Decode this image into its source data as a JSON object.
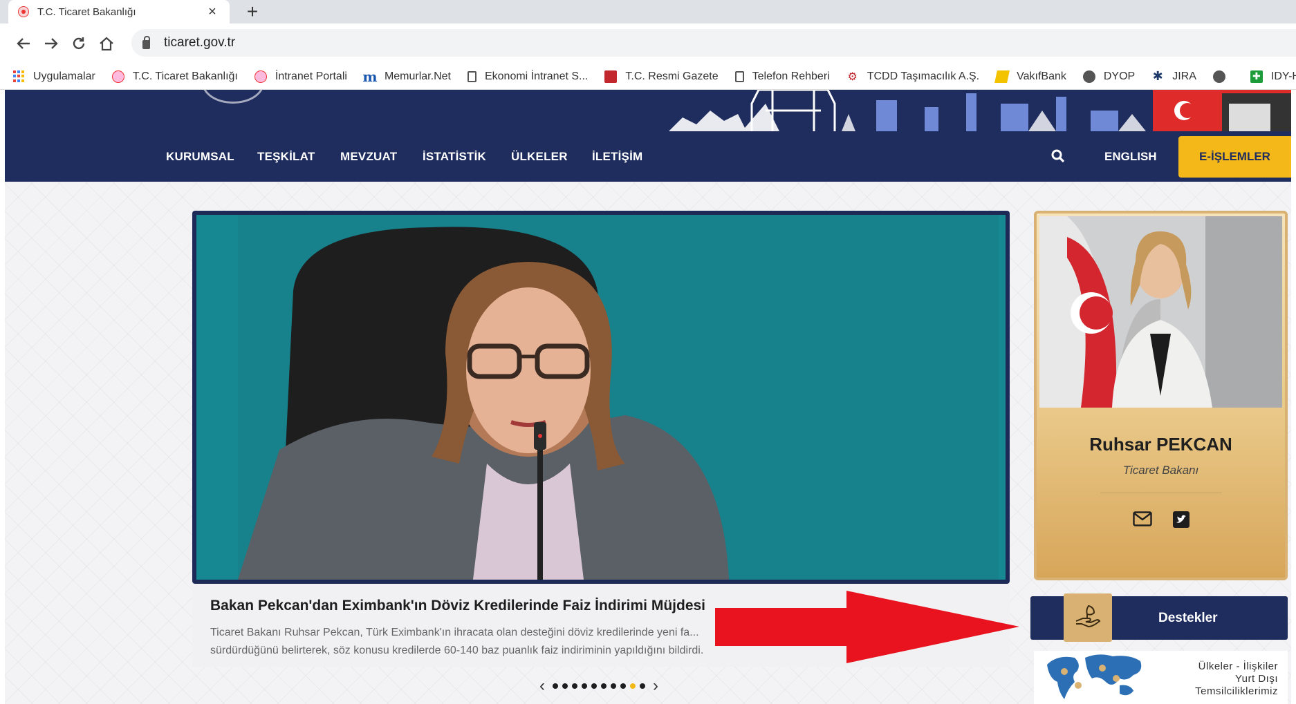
{
  "browser": {
    "tab_title": "T.C. Ticaret Bakanlığı",
    "tab_close": "×",
    "new_tab": "+",
    "url": "ticaret.gov.tr",
    "nav": {
      "back": "←",
      "forward": "→",
      "reload": "↻",
      "home": "⌂"
    }
  },
  "bookmarks": [
    {
      "label": "Uygulamalar",
      "icon": "apps-icon"
    },
    {
      "label": "T.C. Ticaret Bakanlığı",
      "icon": "seal-icon"
    },
    {
      "label": "İntranet Portali",
      "icon": "seal-icon"
    },
    {
      "label": "Memurlar.Net",
      "icon": "m-logo-icon"
    },
    {
      "label": "Ekonomi İntranet S...",
      "icon": "document-icon"
    },
    {
      "label": "T.C. Resmi Gazete",
      "icon": "gazette-icon"
    },
    {
      "label": "Telefon Rehberi",
      "icon": "document-icon"
    },
    {
      "label": "TCDD Taşımacılık A.Ş.",
      "icon": "tcdd-icon"
    },
    {
      "label": "VakıfBank",
      "icon": "vakifbank-icon"
    },
    {
      "label": "DYOP",
      "icon": "globe-icon"
    },
    {
      "label": "JIRA",
      "icon": "jira-icon"
    },
    {
      "label": "",
      "icon": "globe-icon"
    },
    {
      "label": "IDY-HS",
      "icon": "green-icon"
    }
  ],
  "site": {
    "nav": [
      "KURUMSAL",
      "TEŞKİLAT",
      "MEVZUAT",
      "İSTATİSTİK",
      "ÜLKELER",
      "İLETİŞİM"
    ],
    "search_icon": "search-icon",
    "english": "ENGLISH",
    "eislemler": "E-İŞLEMLER",
    "colors": {
      "navy": "#1e2c5e",
      "gold": "#f4b819",
      "card_gold": "#d9b273"
    }
  },
  "slider": {
    "title": "Bakan Pekcan'dan Eximbank'ın Döviz Kredilerinde Faiz İndirimi Müjdesi",
    "text": "Ticaret Bakanı Ruhsar Pekcan, Türk Eximbank'ın ihracata olan desteğini döviz kredilerinde yeni fa... sürdürdüğünü belirterek, söz konusu kredilerde 60-140 baz puanlık faiz indiriminin yapıldığını bildirdi.",
    "prev": "‹",
    "next": "›",
    "dot_count": 10,
    "active_dot": 9
  },
  "minister": {
    "name": "Ruhsar PEKCAN",
    "role": "Ticaret Bakanı"
  },
  "destekler": {
    "label": "Destekler"
  },
  "ulkeler": {
    "line1": "Ülkeler - İlişkiler",
    "line2": "Yurt Dışı",
    "line3": "Temsilciliklerimiz"
  }
}
